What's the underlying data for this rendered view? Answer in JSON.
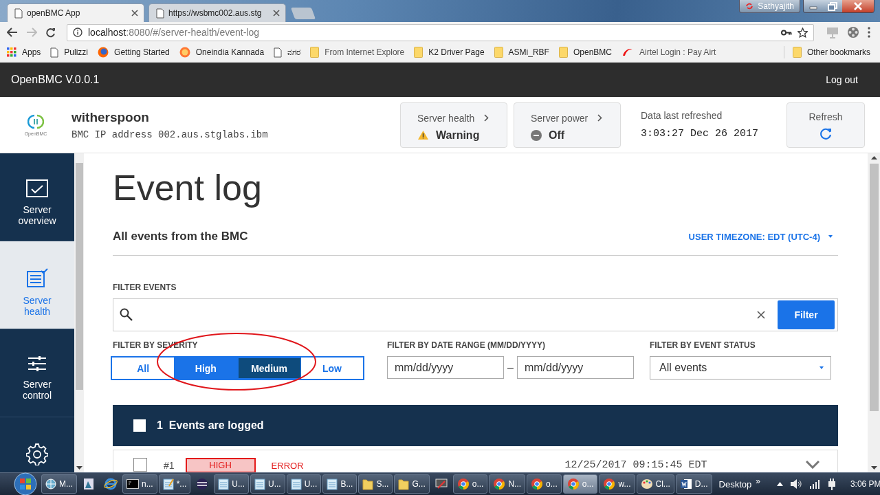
{
  "browser": {
    "tabs": [
      {
        "title": "openBMC App",
        "selected": true
      },
      {
        "title": "https://wsbmc002.aus.stg",
        "selected": false
      }
    ],
    "profile": "Sathyajith",
    "url": {
      "host": "localhost",
      "rest": ":8080/#/server-health/event-log"
    },
    "bookmarks": [
      {
        "label": "Apps",
        "kind": "apps"
      },
      {
        "label": "Pulizzi",
        "kind": "page"
      },
      {
        "label": "Getting Started",
        "kind": "firefox"
      },
      {
        "label": "Oneindia Kannada",
        "kind": "sun"
      },
      {
        "label": "ನಗರ",
        "kind": "page"
      },
      {
        "label": "From Internet Explore",
        "kind": "folder"
      },
      {
        "label": "K2 Driver Page",
        "kind": "folder"
      },
      {
        "label": "ASMi_RBF",
        "kind": "folder"
      },
      {
        "label": "OpenBMC",
        "kind": "folder"
      },
      {
        "label": "Airtel Login : Pay Airt",
        "kind": "airtel"
      }
    ],
    "other_bookmarks": "Other bookmarks"
  },
  "app": {
    "brand": "OpenBMC V.0.0.1",
    "logout": "Log out",
    "logo_text": "OpenBMC",
    "server_name": "witherspoon",
    "ip": "BMC IP address 002.aus.stglabs.ibm",
    "status_cards": [
      {
        "label": "Server health",
        "value": "Warning",
        "kind": "warning"
      },
      {
        "label": "Server power",
        "value": "Off",
        "kind": "off"
      }
    ],
    "refreshed_label": "Data last refreshed",
    "refreshed_time": "3:03:27 Dec 26 2017",
    "refresh": "Refresh"
  },
  "sidebar": [
    {
      "label": "Server overview",
      "kind": "overview",
      "selected": false
    },
    {
      "label": "Server health",
      "kind": "health",
      "selected": true
    },
    {
      "label": "Server control",
      "kind": "control",
      "selected": false
    },
    {
      "kind": "settings",
      "selected": false
    }
  ],
  "page": {
    "title": "Event log",
    "subtitle": "All events from the BMC",
    "timezone": "USER TIMEZONE: EDT (UTC-4)",
    "filter_label": "FILTER EVENTS",
    "filter_button": "Filter",
    "severity_label": "FILTER BY SEVERITY",
    "severity": [
      {
        "label": "All",
        "selected": false,
        "focused": false
      },
      {
        "label": "High",
        "selected": true,
        "focused": false
      },
      {
        "label": "Medium",
        "selected": true,
        "focused": true
      },
      {
        "label": "Low",
        "selected": false,
        "focused": false
      }
    ],
    "date_label": "FILTER BY DATE RANGE (MM/DD/YYYY)",
    "date_from": {
      "placeholder": "mm/dd/yyyy"
    },
    "date_sep": "–",
    "date_to": {
      "placeholder": "mm/dd/yyyy"
    },
    "status_label": "FILTER BY EVENT STATUS",
    "status_value": "All events",
    "summary": {
      "count": "1",
      "text": "Events are logged",
      "checked": false
    },
    "events": [
      {
        "id": "#1",
        "severity": "HIGH",
        "type": "ERROR",
        "time": "12/25/2017 09:15:45 EDT",
        "checked": false
      }
    ]
  },
  "taskbar": {
    "items": [
      {
        "label": "M...",
        "kind": "globe",
        "selected": false
      },
      {
        "kind": "app",
        "selected": false
      },
      {
        "kind": "ie",
        "selected": false
      },
      {
        "label": "n...",
        "kind": "cmd",
        "selected": false
      },
      {
        "label": "*...",
        "kind": "notepad",
        "selected": false
      },
      {
        "kind": "eclipse",
        "selected": false
      },
      {
        "label": "U...",
        "kind": "note",
        "selected": false
      },
      {
        "label": "U...",
        "kind": "note",
        "selected": false
      },
      {
        "label": "U...",
        "kind": "note",
        "selected": false
      },
      {
        "label": "B...",
        "kind": "note",
        "selected": false
      },
      {
        "label": "S...",
        "kind": "folder",
        "selected": false
      },
      {
        "label": "G...",
        "kind": "folder",
        "selected": false
      },
      {
        "kind": "display",
        "selected": false
      },
      {
        "label": "o...",
        "kind": "chrome",
        "selected": false
      },
      {
        "label": "N...",
        "kind": "chrome",
        "selected": false
      },
      {
        "label": "o...",
        "kind": "chrome",
        "selected": false
      },
      {
        "label": "o...",
        "kind": "chrome",
        "selected": true
      },
      {
        "label": "w...",
        "kind": "chrome",
        "selected": false
      },
      {
        "label": "Cl...",
        "kind": "paint",
        "selected": false
      },
      {
        "label": "D...",
        "kind": "word",
        "selected": false
      }
    ],
    "desktop": "Desktop",
    "more": "»",
    "clock": "3:06 PM"
  }
}
